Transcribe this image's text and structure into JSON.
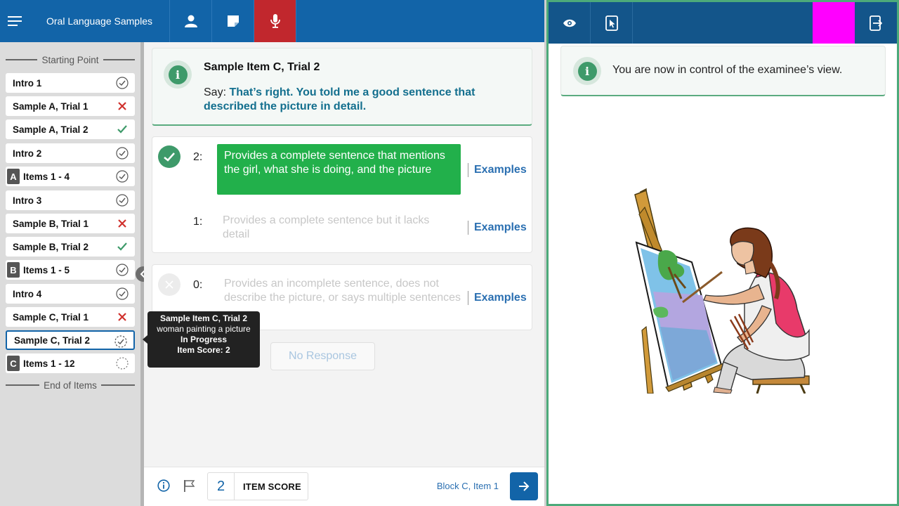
{
  "header": {
    "app_title": "Oral Language Samples",
    "icons": [
      "menu-icon",
      "user-icon",
      "note-icon",
      "microphone-icon"
    ]
  },
  "sidebar": {
    "start_label": "Starting Point",
    "end_label": "End of Items",
    "items": [
      {
        "label": "Intro 1",
        "status": "complete"
      },
      {
        "label": "Sample A, Trial 1",
        "status": "incorrect"
      },
      {
        "label": "Sample A, Trial 2",
        "status": "correct"
      },
      {
        "label": "Intro 2",
        "status": "complete"
      },
      {
        "badge": "A",
        "label": "Items 1 - 4",
        "status": "complete"
      },
      {
        "label": "Intro 3",
        "status": "complete"
      },
      {
        "label": "Sample B, Trial 1",
        "status": "incorrect"
      },
      {
        "label": "Sample B, Trial 2",
        "status": "correct"
      },
      {
        "badge": "B",
        "label": "Items 1 - 5",
        "status": "complete"
      },
      {
        "label": "Intro 4",
        "status": "complete"
      },
      {
        "label": "Sample C, Trial 1",
        "status": "incorrect"
      },
      {
        "label": "Sample C, Trial 2",
        "status": "in-progress"
      },
      {
        "badge": "C",
        "label": "Items 1 - 12",
        "status": "not-started"
      }
    ]
  },
  "tooltip": {
    "title": "Sample Item C, Trial 2",
    "desc": "woman painting a picture",
    "status": "In Progress",
    "score": "Item Score: 2"
  },
  "item": {
    "title": "Sample Item C, Trial 2",
    "say_prefix": "Say:",
    "say_text": "That’s right. You told me a good sentence that described the picture in detail."
  },
  "criteria": [
    {
      "points": "2:",
      "text": "Provides a complete sentence that mentions the girl, what she is doing, and the picture",
      "selected": true,
      "examples": "Examples"
    },
    {
      "points": "1:",
      "text": "Provides a complete sentence but it lacks detail",
      "selected": false,
      "examples": "Examples"
    },
    {
      "points": "0:",
      "text": "Provides an incomplete sentence, does not describe the picture, or says multiple sentences",
      "selected": false,
      "examples": "Examples"
    }
  ],
  "no_response_label": "No Response",
  "footer": {
    "score_value": "2",
    "score_label": "ITEM SCORE",
    "block_label": "Block C, Item 1"
  },
  "examinee": {
    "info_text": "You are now in control of the examinee’s view.",
    "stimulus": "woman-painting-picture",
    "colors": {
      "highlight": "#ff00ff",
      "frame": "#4caa7a"
    }
  },
  "colors": {
    "primary": "#1264a8",
    "mic_active": "#c1272d",
    "selected_green": "#22b04b",
    "incorrect": "#d0312d",
    "correct": "#3e9a6a"
  }
}
